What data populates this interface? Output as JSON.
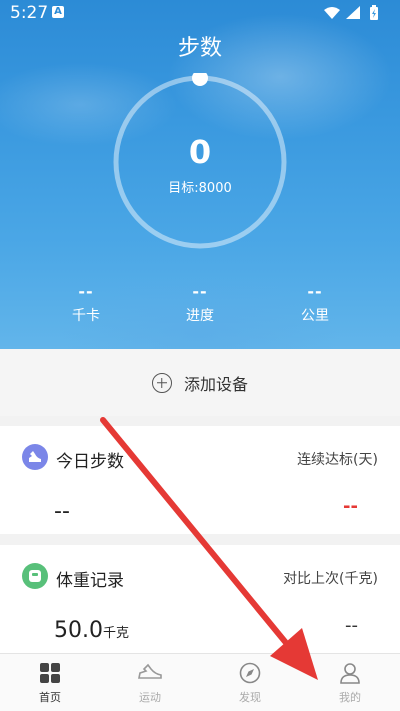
{
  "status_bar": {
    "time": "5:27",
    "notification": "A"
  },
  "header": {
    "title": "步数",
    "steps": "0",
    "goal": "目标:8000",
    "progress_fraction": 0,
    "metrics": [
      {
        "value": "--",
        "label": "千卡"
      },
      {
        "value": "--",
        "label": "进度"
      },
      {
        "value": "--",
        "label": "公里"
      }
    ]
  },
  "add_device": {
    "label": "添加设备"
  },
  "today_steps_card": {
    "title": "今日步数",
    "right_label": "连续达标(天)",
    "left_value": "--",
    "right_value": "--",
    "right_value_color": "#e53935",
    "icon": "shoe-icon",
    "icon_color": "#7b86e8"
  },
  "weight_card": {
    "title": "体重记录",
    "right_label": "对比上次(千克)",
    "left_value": "50.0",
    "left_unit": "千克",
    "right_value": "--",
    "icon": "scale-icon",
    "icon_color": "#58c07a"
  },
  "bottom_nav": [
    {
      "label": "首页",
      "icon": "grid-icon",
      "active": true
    },
    {
      "label": "运动",
      "icon": "sneaker-icon",
      "active": false
    },
    {
      "label": "发现",
      "icon": "compass-icon",
      "active": false
    },
    {
      "label": "我的",
      "icon": "person-icon",
      "active": false
    }
  ],
  "colors": {
    "accent": "#2c8bd6",
    "annotation_arrow": "#e53935"
  }
}
